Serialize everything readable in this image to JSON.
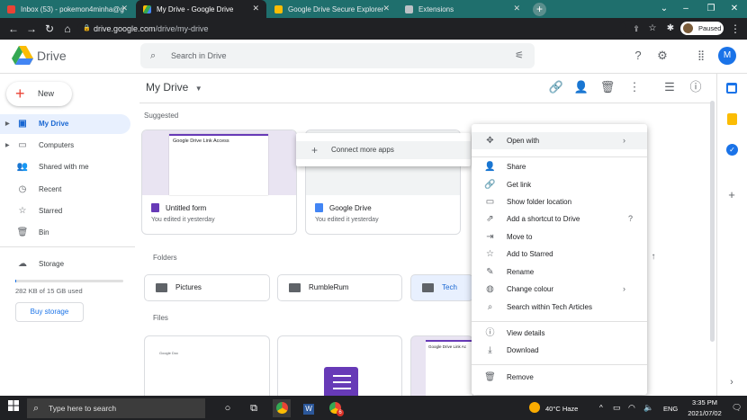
{
  "browser": {
    "tabs": [
      {
        "label": "Inbox (53) - pokemon4minha@g",
        "close": "✕"
      },
      {
        "label": "My Drive - Google Drive",
        "close": "✕"
      },
      {
        "label": "Google Drive Secure Explorer",
        "close": "✕"
      },
      {
        "label": "Extensions",
        "close": "✕"
      }
    ],
    "new_tab": "+",
    "url_host": "drive.google.com",
    "url_path": "/drive/my-drive",
    "profile_status": "Paused"
  },
  "drive": {
    "app_name": "Drive",
    "search_placeholder": "Search in Drive",
    "avatar_letter": "M",
    "new_label": "New",
    "nav": [
      {
        "label": "My Drive"
      },
      {
        "label": "Computers"
      },
      {
        "label": "Shared with me"
      },
      {
        "label": "Recent"
      },
      {
        "label": "Starred"
      },
      {
        "label": "Bin"
      },
      {
        "label": "Storage"
      }
    ],
    "storage_used": "282 KB of 15 GB used",
    "storage_fraction": 2e-05,
    "buy_storage": "Buy storage",
    "breadcrumb": "My Drive",
    "section_suggested": "Suggested",
    "section_folders": "Folders",
    "section_files": "Files",
    "suggested": [
      {
        "name": "Untitled form",
        "sub": "You edited it yesterday",
        "thumb_title": "Google Drive Link Access"
      },
      {
        "name": "Google Drive",
        "sub": "You edited it yesterday"
      }
    ],
    "folders": [
      {
        "name": "Pictures"
      },
      {
        "name": "RumbleRum"
      },
      {
        "name": "Tech Artic"
      }
    ],
    "files": [
      {
        "thumb_title": "Google Doc"
      },
      {
        "thumb_title": ""
      },
      {
        "thumb_title": "Google Drive Link Ac"
      }
    ]
  },
  "submenu": {
    "item": "Connect more apps"
  },
  "context_menu": {
    "items": [
      {
        "label": "Open with",
        "icon": "move-icon"
      },
      {
        "label": "Share",
        "icon": "person-add-icon"
      },
      {
        "label": "Get link",
        "icon": "link-icon"
      },
      {
        "label": "Show folder location",
        "icon": "folder-icon"
      },
      {
        "label": "Add a shortcut to Drive",
        "icon": "shortcut-icon"
      },
      {
        "label": "Move to",
        "icon": "move-to-icon"
      },
      {
        "label": "Add to Starred",
        "icon": "star-icon"
      },
      {
        "label": "Rename",
        "icon": "pencil-icon"
      },
      {
        "label": "Change colour",
        "icon": "palette-icon"
      },
      {
        "label": "Search within Tech Articles",
        "icon": "search-icon"
      },
      {
        "label": "View details",
        "icon": "info-icon"
      },
      {
        "label": "Download",
        "icon": "download-icon"
      },
      {
        "label": "Remove",
        "icon": "trash-icon"
      }
    ]
  },
  "taskbar": {
    "search_placeholder": "Type here to search",
    "weather": "40°C  Haze",
    "language": "ENG",
    "time": "3:35 PM",
    "date": "2021/07/02",
    "word_badge": "W",
    "chrome_badge": "6"
  },
  "colors": {
    "accent": "#1a73e8",
    "tab_strip": "#1f6f6d",
    "selection": "#e8f0fe"
  }
}
